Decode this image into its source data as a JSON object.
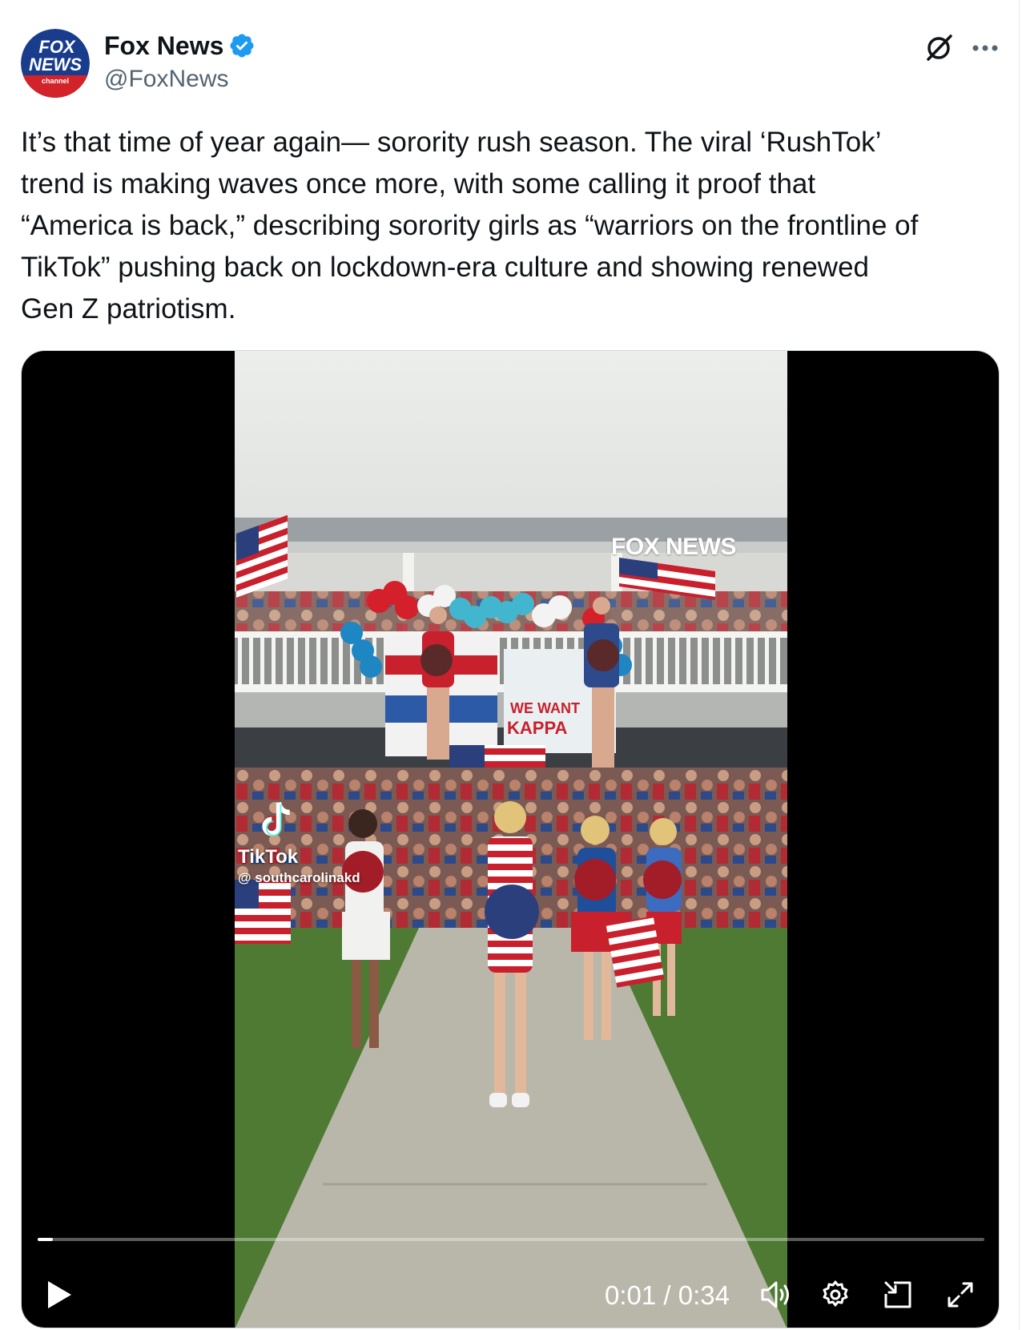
{
  "author": {
    "display_name": "Fox News",
    "handle": "@FoxNews",
    "avatar_icon": "fox-news-logo",
    "avatar_text_top": "FOX",
    "avatar_text_mid": "NEWS",
    "avatar_text_bottom": "channel",
    "verified_icon": "verified-badge-icon"
  },
  "header_actions": {
    "grok_icon": "grok-icon",
    "more_icon": "more-horizontal-icon"
  },
  "tweet": {
    "text": "It’s that time of year again— sorority rush season. The viral ‘RushTok’\ntrend is making waves once more, with some calling it proof that\n“America is back,” describing sorority girls as “warriors on the frontline of\nTikTok” pushing back on lockdown-era culture and showing renewed\nGen Z patriotism."
  },
  "video": {
    "watermark": "FOX NEWS",
    "tiktok_label": "TikTok",
    "tiktok_user": "@ southcarolinakd",
    "banner_text_1": "WE WANT",
    "banner_text_2": "KAPPA",
    "current_time": "0:01",
    "duration": "0:34",
    "time_display": "0:01 / 0:34",
    "progress": 0.016,
    "controls": {
      "play_icon": "play-icon",
      "volume_icon": "volume-icon",
      "settings_icon": "settings-gear-icon",
      "pip_icon": "picture-in-picture-icon",
      "fullscreen_icon": "fullscreen-icon"
    }
  },
  "colors": {
    "verified_blue": "#1d9bf0",
    "text_primary": "#0f1419",
    "text_secondary": "#536471",
    "fox_blue": "#1a3c8c",
    "fox_red": "#d2232a"
  }
}
